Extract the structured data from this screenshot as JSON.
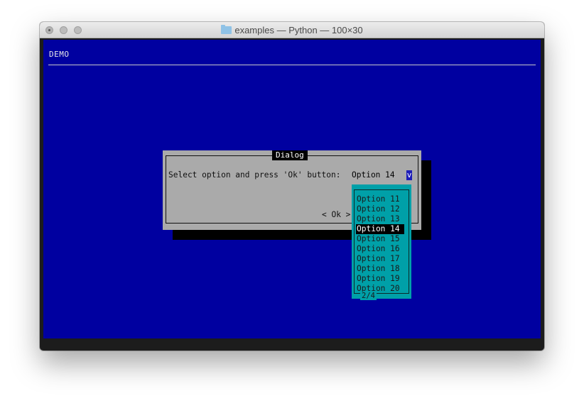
{
  "window": {
    "title": "examples — Python — 100×30"
  },
  "app": {
    "title": "DEMO"
  },
  "dialog": {
    "title": "Dialog",
    "prompt": "Select option and press 'Ok' button:",
    "select": {
      "value": "Option 14",
      "arrow": "v"
    },
    "ok_button": "< Ok >"
  },
  "dropdown": {
    "items": [
      {
        "label": "Option 11",
        "selected": false
      },
      {
        "label": "Option 12",
        "selected": false
      },
      {
        "label": "Option 13",
        "selected": false
      },
      {
        "label": "Option 14",
        "selected": true
      },
      {
        "label": "Option 15",
        "selected": false
      },
      {
        "label": "Option 16",
        "selected": false
      },
      {
        "label": "Option 17",
        "selected": false
      },
      {
        "label": "Option 18",
        "selected": false
      },
      {
        "label": "Option 19",
        "selected": false
      },
      {
        "label": "Option 20",
        "selected": false
      }
    ],
    "page": "2/4"
  },
  "colors": {
    "terminal_bg": "#0000a0",
    "dialog_bg": "#aaaaaa",
    "dropdown_bg": "#00a0a8",
    "selection_bg": "#000000"
  }
}
